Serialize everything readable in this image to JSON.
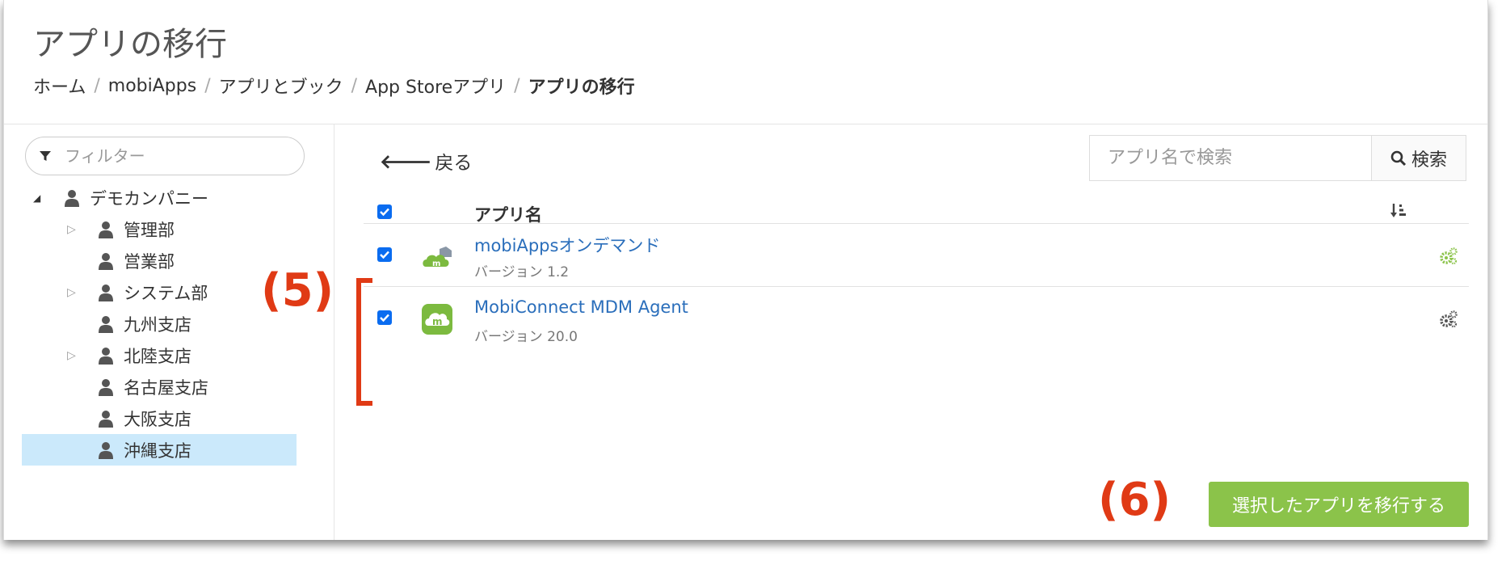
{
  "page": {
    "title": "アプリの移行",
    "breadcrumb": [
      {
        "label": "ホーム"
      },
      {
        "label": "mobiApps"
      },
      {
        "label": "アプリとブック"
      },
      {
        "label": "App Storeアプリ"
      },
      {
        "label": "アプリの移行"
      }
    ],
    "breadcrumb_separator": "/"
  },
  "sidebar": {
    "filter_placeholder": "フィルター",
    "tree": [
      {
        "label": "デモカンパニー",
        "toggle": "open"
      },
      {
        "label": "管理部",
        "toggle": "closed"
      },
      {
        "label": "営業部",
        "toggle": "none"
      },
      {
        "label": "システム部",
        "toggle": "closed"
      },
      {
        "label": "九州支店",
        "toggle": "none"
      },
      {
        "label": "北陸支店",
        "toggle": "closed"
      },
      {
        "label": "名古屋支店",
        "toggle": "none"
      },
      {
        "label": "大阪支店",
        "toggle": "none"
      },
      {
        "label": "沖縄支店",
        "toggle": "none",
        "selected": true
      }
    ]
  },
  "toolbar": {
    "back_label": "戻る",
    "search_placeholder": "アプリ名で検索",
    "search_button": "検索"
  },
  "table": {
    "header_app_name": "アプリ名",
    "select_all_checked": true,
    "rows": [
      {
        "name": "mobiAppsオンデマンド",
        "version": "バージョン 1.2",
        "checked": true,
        "gear_color": "#8bc34a",
        "icon": "cloud-m-gray-icon"
      },
      {
        "name": "MobiConnect MDM Agent",
        "version": "バージョン 20.0",
        "checked": true,
        "gear_color": "#555555",
        "icon": "mobiconnect-icon"
      }
    ]
  },
  "actions": {
    "migrate_label": "選択したアプリを移行する",
    "migrate_color": "#8bc34a"
  },
  "annotations": {
    "label_5": "(5)",
    "label_6": "(6)",
    "color": "#e03a15"
  }
}
